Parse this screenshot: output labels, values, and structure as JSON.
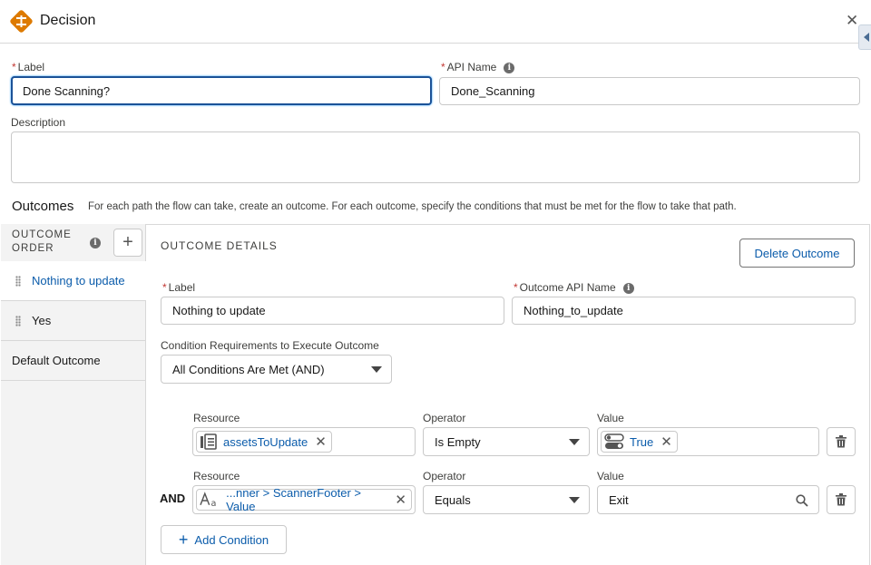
{
  "header": {
    "title": "Decision",
    "close_glyph": "✕"
  },
  "form": {
    "label_label": "Label",
    "label_value": "Done Scanning?",
    "api_label": "API Name",
    "api_value": "Done_Scanning",
    "description_label": "Description",
    "description_value": ""
  },
  "outcomes": {
    "title": "Outcomes",
    "description": "For each path the flow can take, create an outcome. For each outcome, specify the conditions that must be met for the flow to take that path.",
    "order_header_line1": "OUTCOME",
    "order_header_line2": "ORDER",
    "items": [
      {
        "label": "Nothing to update"
      },
      {
        "label": "Yes"
      },
      {
        "label": "Default Outcome"
      }
    ]
  },
  "details": {
    "header": "OUTCOME DETAILS",
    "delete_button": "Delete Outcome",
    "label_label": "Label",
    "label_value": "Nothing to update",
    "api_label": "Outcome API Name",
    "api_value": "Nothing_to_update",
    "requirements_label": "Condition Requirements to Execute Outcome",
    "requirements_value": "All Conditions Are Met (AND)",
    "resource_label": "Resource",
    "operator_label": "Operator",
    "value_label": "Value",
    "conditions": [
      {
        "prefix": "",
        "resource": "assetsToUpdate",
        "operator": "Is Empty",
        "value": "True"
      },
      {
        "prefix": "AND",
        "resource": "...nner > ScannerFooter > Value",
        "operator": "Equals",
        "value": "Exit"
      }
    ],
    "add_condition": "Add Condition"
  },
  "colors": {
    "accent": "#0b5cab",
    "decision_icon": "#dd7a01",
    "required": "#c23934"
  }
}
